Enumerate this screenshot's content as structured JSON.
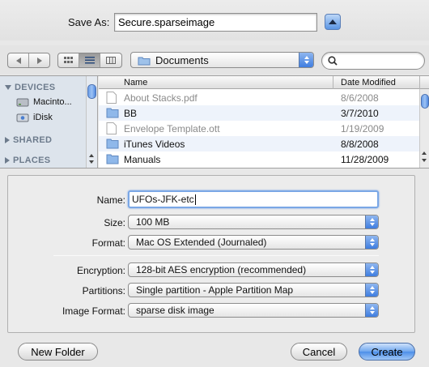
{
  "dialog": {
    "save_as_label": "Save As:",
    "save_as_value": "Secure.sparseimage"
  },
  "toolbar": {
    "location": "Documents",
    "search_placeholder": ""
  },
  "sidebar": {
    "sections": [
      {
        "label": "DEVICES",
        "expanded": true
      },
      {
        "label": "SHARED",
        "expanded": false
      },
      {
        "label": "PLACES",
        "expanded": false
      }
    ],
    "devices": [
      {
        "label": "Macinto...",
        "icon": "hard-drive-icon"
      },
      {
        "label": "iDisk",
        "icon": "idisk-icon"
      }
    ]
  },
  "file_list": {
    "columns": {
      "name": "Name",
      "date": "Date Modified"
    },
    "rows": [
      {
        "name": "About Stacks.pdf",
        "date": "8/6/2008",
        "kind": "file",
        "dim": true
      },
      {
        "name": "BB",
        "date": "3/7/2010",
        "kind": "folder",
        "dim": false
      },
      {
        "name": "Envelope Template.ott",
        "date": "1/19/2009",
        "kind": "file",
        "dim": true
      },
      {
        "name": "iTunes Videos",
        "date": "8/8/2008",
        "kind": "folder",
        "dim": false
      },
      {
        "name": "Manuals",
        "date": "11/28/2009",
        "kind": "folder",
        "dim": false
      }
    ]
  },
  "options": {
    "name_label": "Name:",
    "name_value": "UFOs-JFK-etc",
    "size_label": "Size:",
    "size_value": "100 MB",
    "format_label": "Format:",
    "format_value": "Mac OS Extended (Journaled)",
    "encryption_label": "Encryption:",
    "encryption_value": "128-bit AES encryption (recommended)",
    "partitions_label": "Partitions:",
    "partitions_value": "Single partition - Apple Partition Map",
    "image_format_label": "Image Format:",
    "image_format_value": "sparse disk image"
  },
  "buttons": {
    "new_folder": "New Folder",
    "cancel": "Cancel",
    "create": "Create"
  },
  "colors": {
    "accent": "#4c8ee8",
    "sidebar_bg": "#dde4ec",
    "alt_row": "#eef3fb"
  }
}
